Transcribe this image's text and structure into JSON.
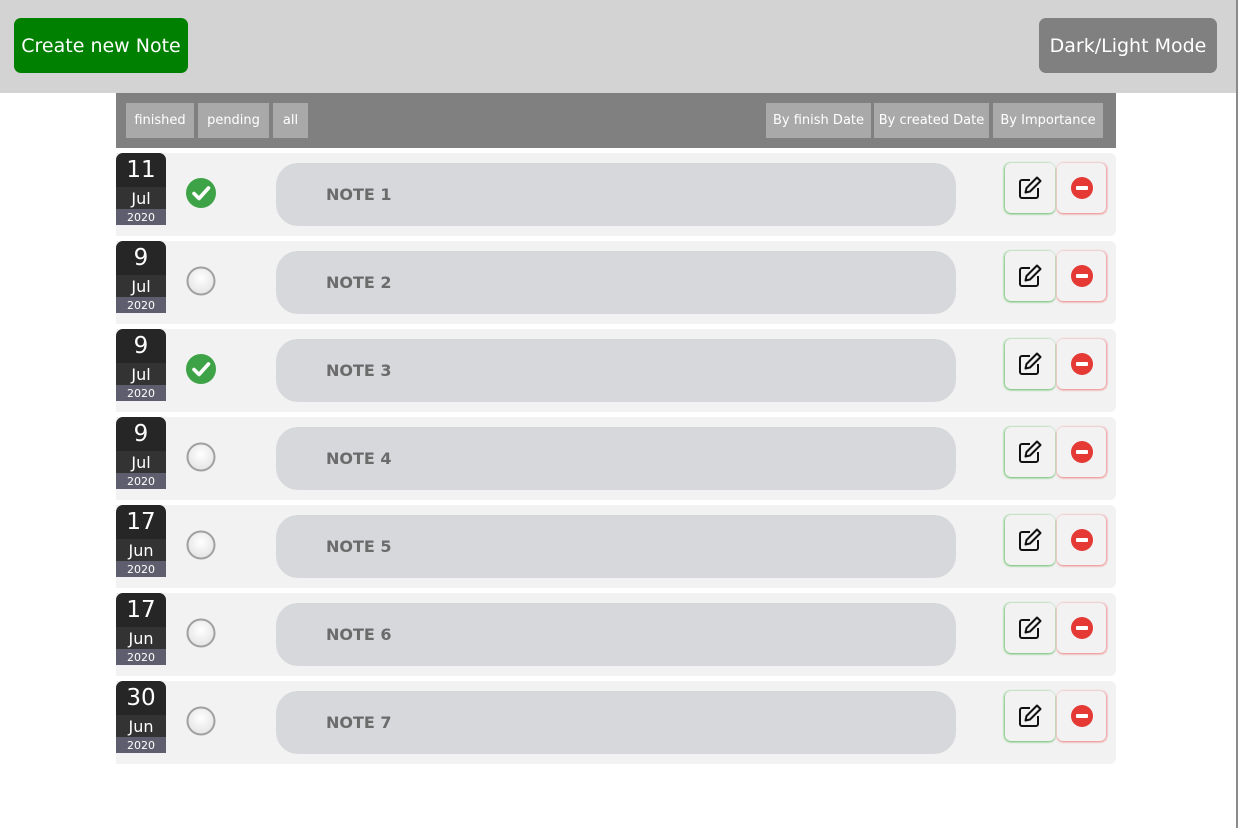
{
  "header": {
    "create_label": "Create new Note",
    "mode_label": "Dark/Light Mode"
  },
  "filters": {
    "finished": "finished",
    "pending": "pending",
    "all": "all",
    "by_finish_date": "By finish Date",
    "by_created_date": "By created Date",
    "by_importance": "By Importance"
  },
  "notes": [
    {
      "day": "11",
      "month": "Jul",
      "year": "2020",
      "title": "NOTE 1",
      "finished": true
    },
    {
      "day": "9",
      "month": "Jul",
      "year": "2020",
      "title": "NOTE 2",
      "finished": false
    },
    {
      "day": "9",
      "month": "Jul",
      "year": "2020",
      "title": "NOTE 3",
      "finished": true
    },
    {
      "day": "9",
      "month": "Jul",
      "year": "2020",
      "title": "NOTE 4",
      "finished": false
    },
    {
      "day": "17",
      "month": "Jun",
      "year": "2020",
      "title": "NOTE 5",
      "finished": false
    },
    {
      "day": "17",
      "month": "Jun",
      "year": "2020",
      "title": "NOTE 6",
      "finished": false
    },
    {
      "day": "30",
      "month": "Jun",
      "year": "2020",
      "title": "NOTE 7",
      "finished": false
    }
  ],
  "icons": {
    "status_done": "check-circle-icon",
    "status_open": "empty-circle-icon",
    "edit": "edit-icon",
    "delete": "minus-circle-icon"
  },
  "colors": {
    "create_button": "#008000",
    "mode_button": "#808080",
    "check_green": "#3ea346",
    "delete_red": "#e53935"
  }
}
